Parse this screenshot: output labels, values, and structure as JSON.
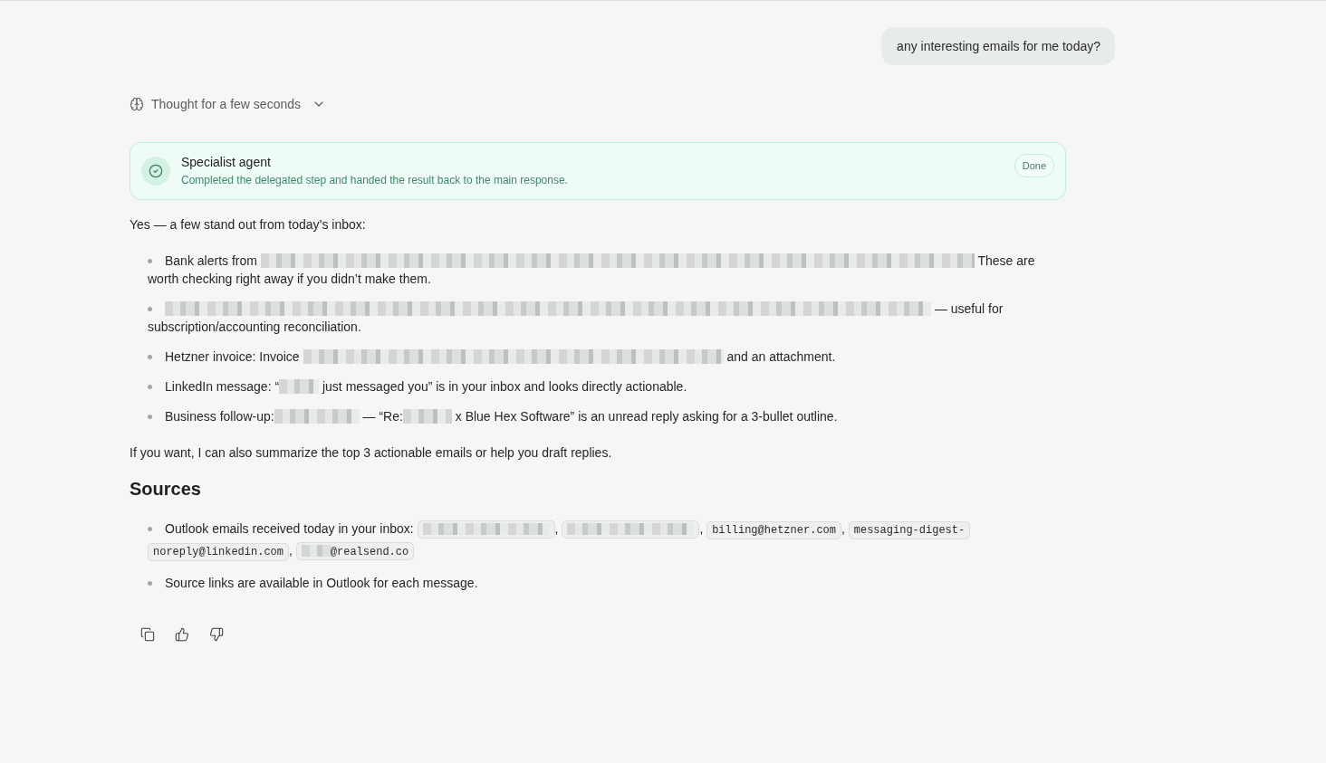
{
  "user_message": {
    "text": "any interesting emails for me today?"
  },
  "thought": {
    "label": "Thought for a few seconds",
    "expanded": false
  },
  "agent_card": {
    "title": "Specialist agent",
    "description": "Completed the delegated step and handed the result back to the main response.",
    "status": "Done"
  },
  "response": {
    "intro": "Yes — a few stand out from today’s inbox:",
    "bullets": [
      {
        "parts": [
          {
            "kind": "text",
            "text": "Bank alerts from "
          },
          {
            "kind": "blurline"
          },
          {
            "kind": "text",
            "text": " These are "
          },
          {
            "kind": "text",
            "text": "worth checking right away if you didn’t make them."
          }
        ]
      },
      {
        "parts": [
          {
            "kind": "blurfull"
          },
          {
            "kind": "text",
            "text": " — useful for "
          },
          {
            "kind": "text",
            "text": "subscription/accounting reconciliation."
          }
        ]
      },
      {
        "parts": [
          {
            "kind": "text",
            "text": "Hetzner invoice: Invoice "
          },
          {
            "kind": "blurwide"
          },
          {
            "kind": "text",
            "text": " and an attachment."
          }
        ]
      },
      {
        "parts": [
          {
            "kind": "text",
            "text": "LinkedIn message: “"
          },
          {
            "kind": "blurtiny"
          },
          {
            "kind": "text",
            "text": " just messaged you” is in your inbox and looks directly actionable."
          }
        ]
      },
      {
        "parts": [
          {
            "kind": "text",
            "text": "Business follow-up:"
          },
          {
            "kind": "blurword"
          },
          {
            "kind": "text",
            "text": " — “Re:"
          },
          {
            "kind": "blurshort"
          },
          {
            "kind": "text",
            "text": " x Blue Hex Software” is an unread reply asking for a 3-bullet outline."
          }
        ]
      }
    ],
    "closing": "If you want, I can also summarize the top 3 actionable emails or help you draft replies.",
    "sources": {
      "heading": "Sources",
      "bullets": [
        {
          "parts": [
            {
              "kind": "text",
              "text": "Outlook emails received today in your inbox: "
            },
            {
              "kind": "code",
              "parts": [
                {
                  "kind": "blurchip"
                }
              ]
            },
            {
              "kind": "text",
              "text": ", "
            },
            {
              "kind": "code",
              "parts": [
                {
                  "kind": "blurchip"
                }
              ]
            },
            {
              "kind": "text",
              "text": ", "
            },
            {
              "kind": "code",
              "parts": [
                {
                  "kind": "text",
                  "text": "billing@hetzner.com"
                }
              ]
            },
            {
              "kind": "text",
              "text": ", "
            },
            {
              "kind": "code",
              "parts": [
                {
                  "kind": "text",
                  "text": "messaging-digest-"
                }
              ]
            },
            {
              "kind": "code",
              "parts": [
                {
                  "kind": "text",
                  "text": "noreply@linkedin.com"
                }
              ]
            },
            {
              "kind": "text",
              "text": ", "
            },
            {
              "kind": "code",
              "parts": [
                {
                  "kind": "blurstub"
                },
                {
                  "kind": "text",
                  "text": "@realsend.co"
                }
              ]
            }
          ]
        },
        {
          "parts": [
            {
              "kind": "text",
              "text": "Source links are available in Outlook for each message."
            }
          ]
        }
      ]
    }
  }
}
